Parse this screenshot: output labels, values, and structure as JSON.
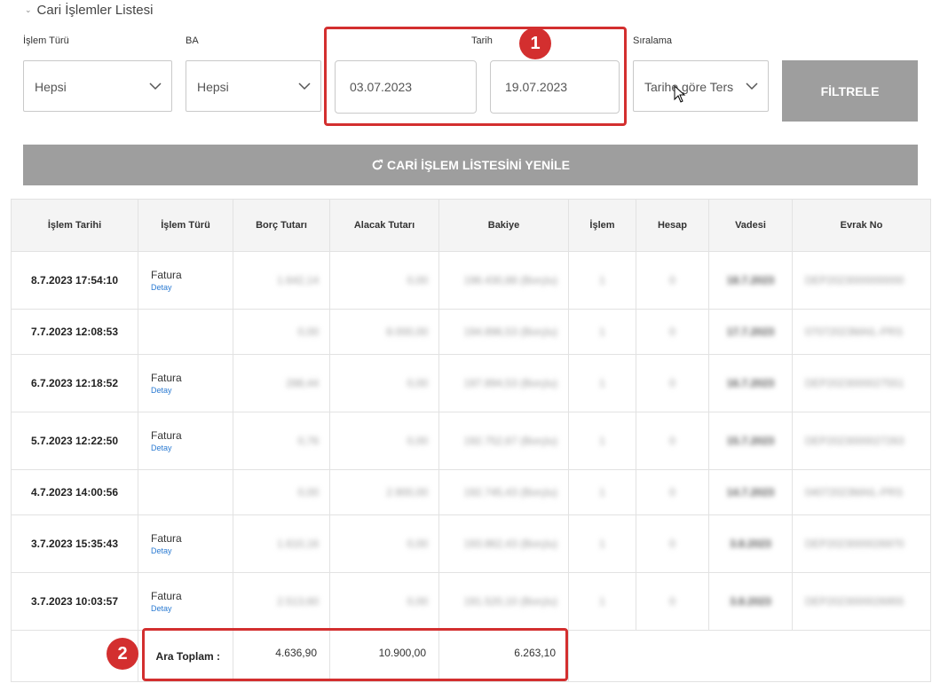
{
  "section": {
    "title": "Cari İşlemler Listesi"
  },
  "filters": {
    "islem_turu_label": "İşlem Türü",
    "islem_turu_value": "Hepsi",
    "ba_label": "BA",
    "ba_value": "Hepsi",
    "tarih_label": "Tarih",
    "date_start": "03.07.2023",
    "date_end": "19.07.2023",
    "siralama_label": "Sıralama",
    "siralama_value": "Tarihe göre Ters",
    "filter_button": "FİLTRELE"
  },
  "refresh_button": "CARİ İŞLEM LİSTESİNİ YENİLE",
  "annotations": {
    "badge1": "1",
    "badge2": "2",
    "color": "#d32f2f"
  },
  "table": {
    "headers": [
      "İşlem Tarihi",
      "İşlem Türü",
      "Borç Tutarı",
      "Alacak Tutarı",
      "Bakiye",
      "İşlem",
      "Hesap",
      "Vadesi",
      "Evrak No"
    ],
    "rows": [
      {
        "date": "8.7.2023 17:54:10",
        "type": "Fatura",
        "detail": "Detay",
        "borc": "1.642,14",
        "alacak": "0,00",
        "bakiye": "196.430,88 (Borçlu)",
        "islem": "1",
        "hesap": "0",
        "vade": "18.7.2023",
        "evrak": "DEP2023000000000"
      },
      {
        "date": "7.7.2023 12:08:53",
        "type": "",
        "detail": "",
        "borc": "0,00",
        "alacak": "8.000,00",
        "bakiye": "194.896,53 (Borçlu)",
        "islem": "1",
        "hesap": "0",
        "vade": "17.7.2023",
        "evrak": "07072023MAIL-PRS"
      },
      {
        "date": "6.7.2023 12:18:52",
        "type": "Fatura",
        "detail": "Detay",
        "borc": "288,44",
        "alacak": "0,00",
        "bakiye": "197.894,53 (Borçlu)",
        "islem": "1",
        "hesap": "0",
        "vade": "16.7.2023",
        "evrak": "DEP2023000027551"
      },
      {
        "date": "5.7.2023 12:22:50",
        "type": "Fatura",
        "detail": "Detay",
        "borc": "0,76",
        "alacak": "0,00",
        "bakiye": "192.752,67 (Borçlu)",
        "islem": "1",
        "hesap": "0",
        "vade": "15.7.2023",
        "evrak": "DEP2023000027263"
      },
      {
        "date": "4.7.2023 14:00:56",
        "type": "",
        "detail": "",
        "borc": "0,00",
        "alacak": "2.900,00",
        "bakiye": "192.745,43 (Borçlu)",
        "islem": "1",
        "hesap": "0",
        "vade": "14.7.2023",
        "evrak": "04072023MAIL-PRS"
      },
      {
        "date": "3.7.2023 15:35:43",
        "type": "Fatura",
        "detail": "Detay",
        "borc": "1.610,16",
        "alacak": "0,00",
        "bakiye": "193.862,43 (Borçlu)",
        "islem": "1",
        "hesap": "0",
        "vade": "3.8.2023",
        "evrak": "DEP2023000026970"
      },
      {
        "date": "3.7.2023 10:03:57",
        "type": "Fatura",
        "detail": "Detay",
        "borc": "2.513,60",
        "alacak": "0,00",
        "bakiye": "191.520,10 (Borçlu)",
        "islem": "1",
        "hesap": "0",
        "vade": "3.8.2023",
        "evrak": "DEP2023000026955"
      }
    ],
    "totals": {
      "label": "Ara Toplam :",
      "borc": "4.636,90",
      "alacak": "10.900,00",
      "bakiye": "6.263,10"
    }
  }
}
